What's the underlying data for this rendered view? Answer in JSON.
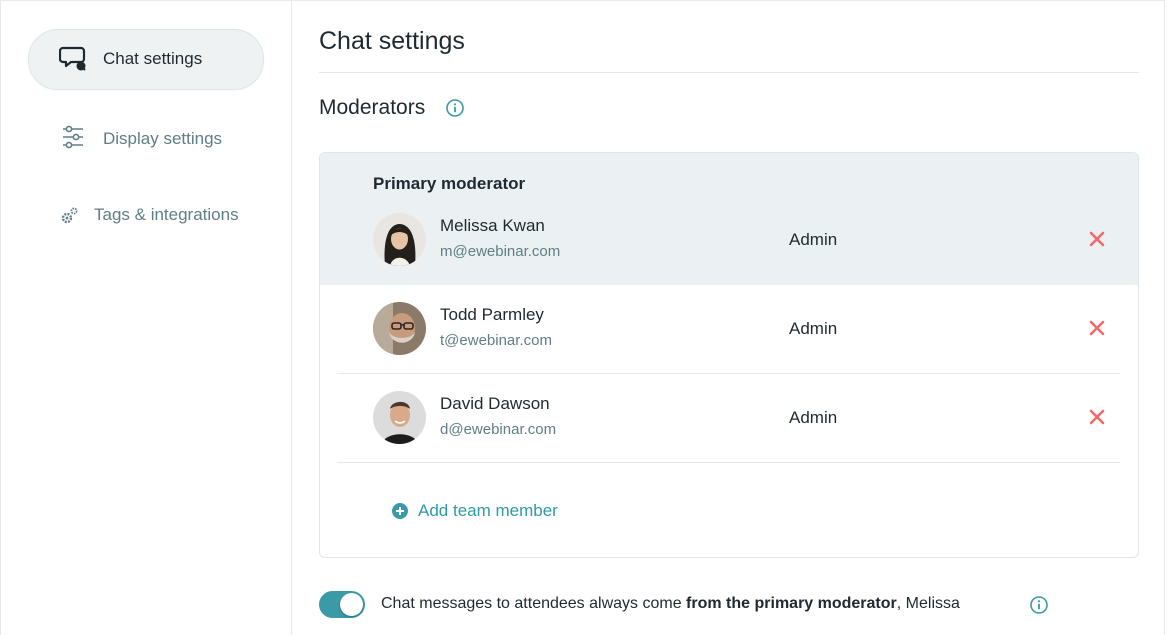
{
  "sidebar": {
    "items": [
      {
        "label": "Chat settings",
        "icon": "chat-bubbles-icon",
        "active": true
      },
      {
        "label": "Display settings",
        "icon": "sliders-icon",
        "active": false
      },
      {
        "label": "Tags & integrations",
        "icon": "gears-icon",
        "active": false
      }
    ]
  },
  "main": {
    "title": "Chat settings",
    "moderators": {
      "title": "Moderators",
      "info_icon": "info-icon",
      "primary_heading": "Primary moderator",
      "members": [
        {
          "name": "Melissa Kwan",
          "email": "m@ewebinar.com",
          "role": "Admin",
          "primary": true
        },
        {
          "name": "Todd Parmley",
          "email": "t@ewebinar.com",
          "role": "Admin",
          "primary": false
        },
        {
          "name": "David Dawson",
          "email": "d@ewebinar.com",
          "role": "Admin",
          "primary": false
        }
      ],
      "add_label": "Add team member"
    },
    "toggle": {
      "on": true,
      "text_before": "Chat messages to attendees always come ",
      "text_bold": "from the primary moderator",
      "text_after": ", Melissa"
    }
  },
  "colors": {
    "accent": "#3a9aa5",
    "remove": "#f06a6a",
    "primary_bg": "#ebf0f2",
    "muted_text": "#5f7e86"
  }
}
